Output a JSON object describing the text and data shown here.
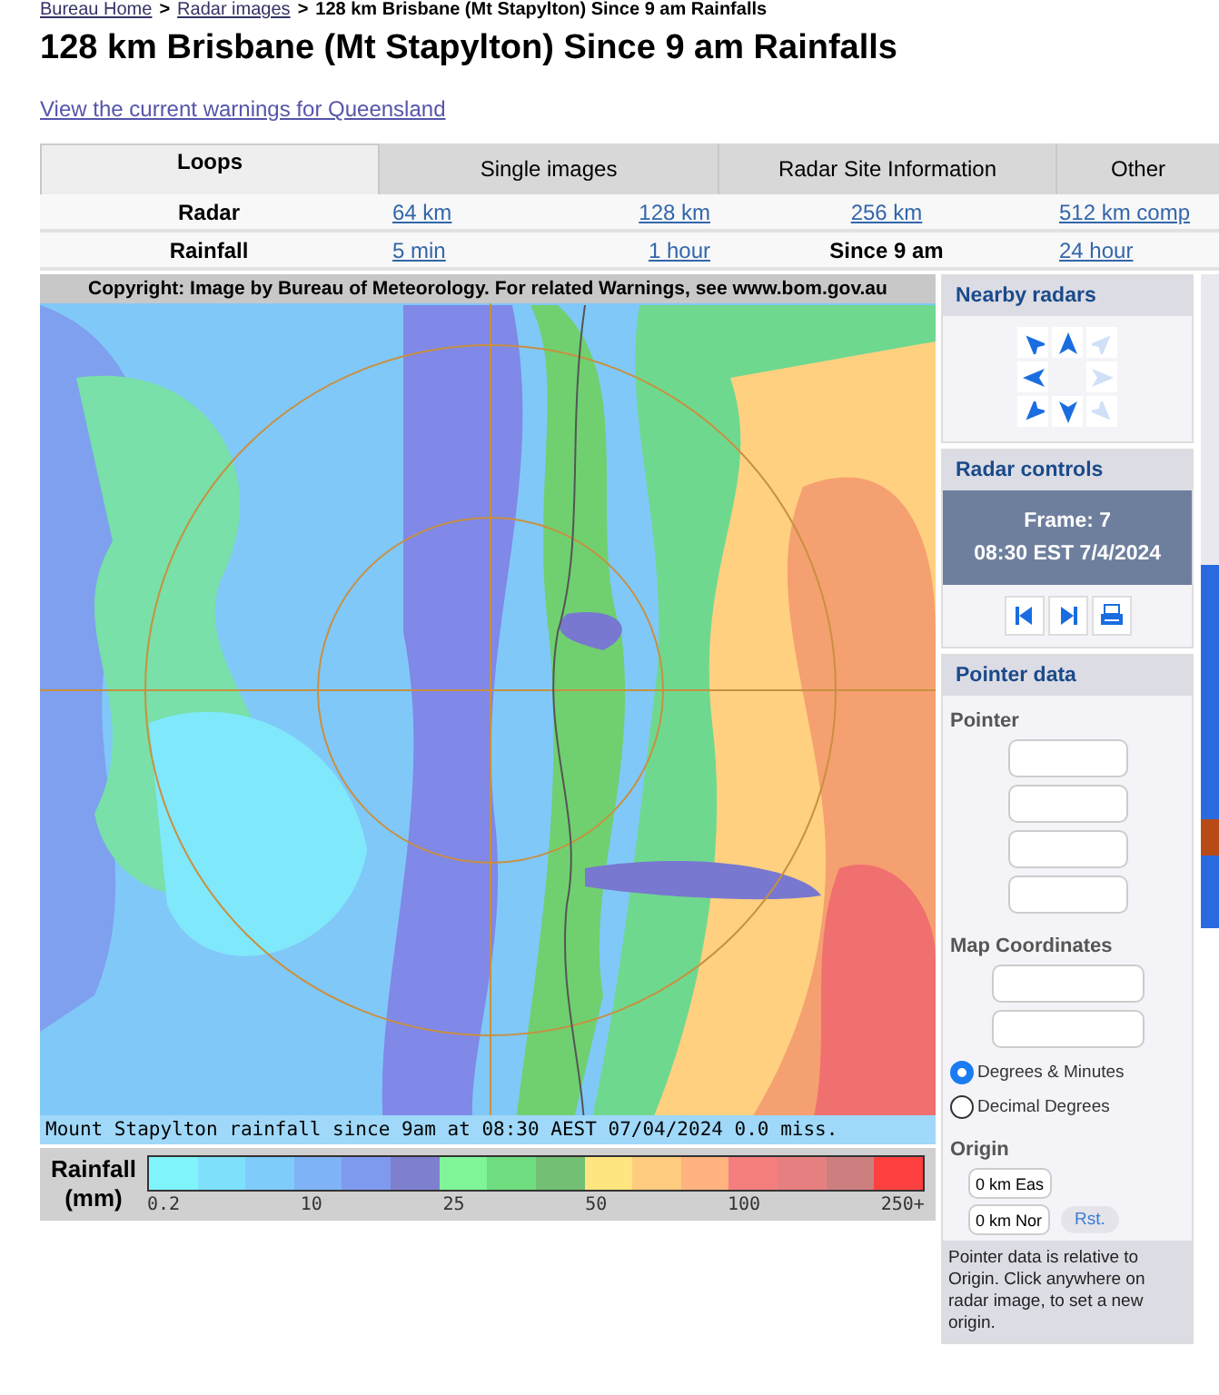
{
  "breadcrumb": [
    {
      "text": "Bureau Home",
      "kind": "link"
    },
    {
      "text": ">",
      "kind": "separator"
    },
    {
      "text": "Radar images",
      "kind": "link"
    },
    {
      "text": ">",
      "kind": "separator"
    },
    {
      "text": "128 km Brisbane (Mt Stapylton) Since 9 am Rainfalls",
      "kind": "current"
    }
  ],
  "title": "128 km Brisbane (Mt Stapylton) Since 9 am Rainfalls",
  "warnings_link": "View the current warnings for Queensland",
  "tabs": [
    {
      "label": "Loops",
      "selected": true
    },
    {
      "label": "Single images",
      "selected": false
    },
    {
      "label": "Radar Site Information",
      "selected": false
    },
    {
      "label": "Other",
      "selected": false
    }
  ],
  "rows": [
    {
      "label": "Radar",
      "cells": [
        {
          "text": "64 km",
          "selected": false
        },
        {
          "text": "128 km",
          "selected": false
        },
        {
          "text": "256 km",
          "selected": false
        },
        {
          "text": "512 km comp",
          "selected": false
        }
      ]
    },
    {
      "label": "Rainfall",
      "cells": [
        {
          "text": "5 min",
          "selected": false
        },
        {
          "text": "1 hour",
          "selected": false
        },
        {
          "text": "Since 9 am",
          "selected": true
        },
        {
          "text": "24 hour",
          "selected": false
        }
      ]
    }
  ],
  "map": {
    "copyright": "Copyright: Image by Bureau of Meteorology. For related Warnings, see www.bom.gov.au",
    "caption": "Mount Stapylton rainfall since 9am at 08:30 AEST 07/04/2024 0.0 miss."
  },
  "legend": {
    "title": "Rainfall",
    "unit": "(mm)",
    "ticks": [
      "0.2",
      "10",
      "25",
      "50",
      "100",
      "250+"
    ]
  },
  "nearby_radars": {
    "title": "Nearby radars",
    "arrows": [
      {
        "disabled": false
      },
      {
        "disabled": false
      },
      {
        "disabled": true
      },
      {
        "disabled": false
      },
      null,
      {
        "disabled": true
      },
      {
        "disabled": false
      },
      {
        "disabled": false
      },
      {
        "disabled": true
      }
    ]
  },
  "radar_controls": {
    "title": "Radar controls",
    "frame": "Frame: 7",
    "time": "08:30 EST 7/4/2024",
    "buttons": [
      {
        "kind": "previous"
      },
      {
        "kind": "next"
      },
      {
        "kind": "print"
      }
    ]
  },
  "pointer_data": {
    "title": "Pointer data",
    "pointer_label": "Pointer",
    "coords_label": "Map Coordinates",
    "options": [
      {
        "label": "Degrees & Minutes",
        "selected": true
      },
      {
        "label": "Decimal Degrees",
        "selected": false
      }
    ],
    "origin_label": "Origin",
    "origin_east": "0 km Eas",
    "origin_north": "0 km Nor",
    "reset": "Rst.",
    "note": "Pointer data is relative to Origin. Click anywhere on radar image, to set a new origin."
  }
}
